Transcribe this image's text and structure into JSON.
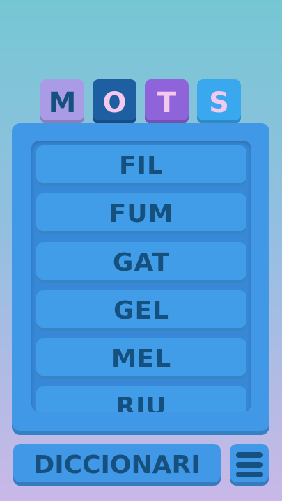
{
  "title_tiles": [
    {
      "letter": "M",
      "bg": "#a99be6",
      "fg": "#16507e"
    },
    {
      "letter": "O",
      "bg": "#1e5fa2",
      "fg": "#f3c9ee"
    },
    {
      "letter": "T",
      "bg": "#8f63d9",
      "fg": "#f3c9ee"
    },
    {
      "letter": "S",
      "bg": "#39a8ef",
      "fg": "#f3c9ee"
    }
  ],
  "words": [
    "FIL",
    "FUM",
    "GAT",
    "GEL",
    "MEL",
    "RIU"
  ],
  "footer": {
    "dictionary_label": "DICCIONARI",
    "menu_icon": "hamburger-icon"
  },
  "colors": {
    "panel": "#4098e6",
    "text": "#16507e"
  }
}
